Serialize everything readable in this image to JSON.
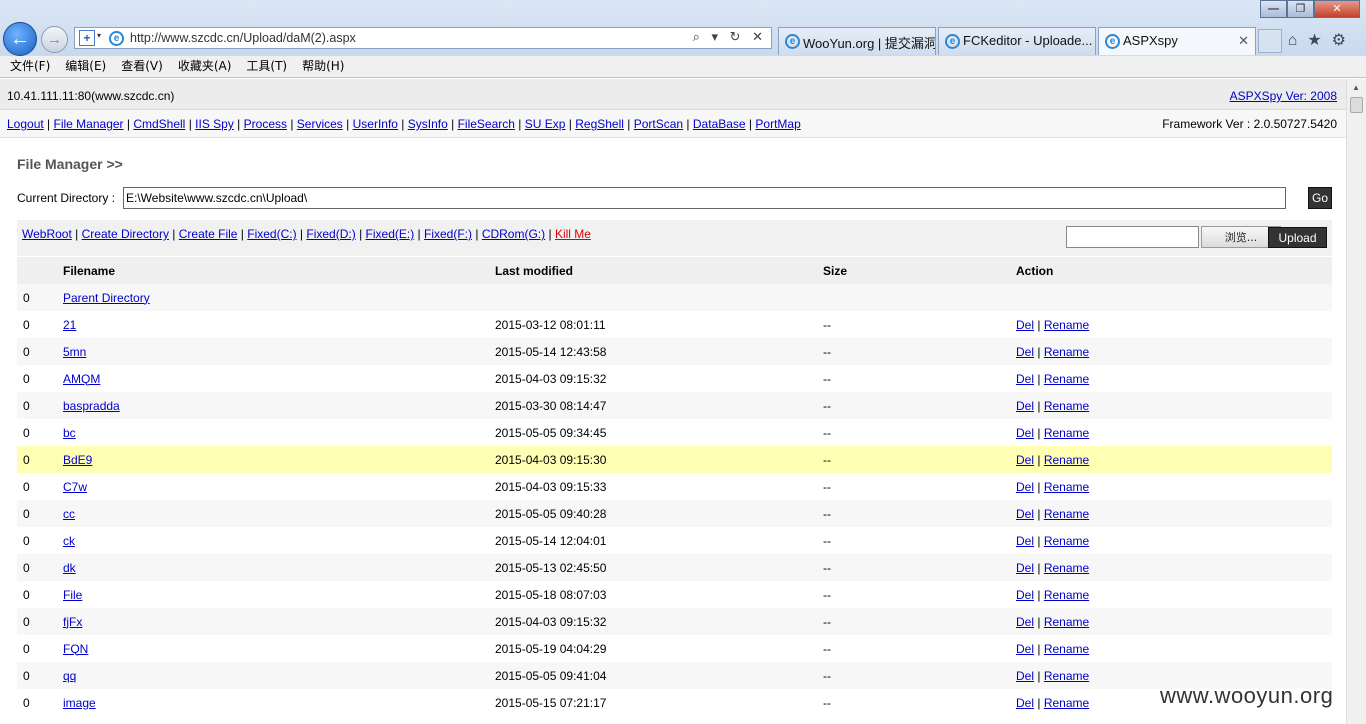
{
  "window": {
    "minimize": "—",
    "maximize": "❐",
    "close": "✕"
  },
  "address": {
    "url": "http://www.szcdc.cn/Upload/daM(2).aspx",
    "tools": "⌕ ▾ ↻ ✕"
  },
  "tabs": [
    {
      "label": "WooYun.org | 提交漏洞"
    },
    {
      "label": "FCKeditor - Uploade..."
    },
    {
      "label": "ASPXspy",
      "active": true,
      "close": "✕"
    }
  ],
  "toolbar_icons": [
    "home-icon",
    "star-icon",
    "gear-icon"
  ],
  "menu": [
    "文件(F)",
    "编辑(E)",
    "查看(V)",
    "收藏夹(A)",
    "工具(T)",
    "帮助(H)"
  ],
  "header": {
    "host": "10.41.111.11:80(www.szcdc.cn)",
    "version_link": "ASPXSpy Ver: 2008",
    "framework": "Framework Ver : 2.0.50727.5420"
  },
  "nav_links": [
    "Logout",
    "File Manager",
    "CmdShell",
    "IIS Spy",
    "Process",
    "Services",
    "UserInfo",
    "SysInfo",
    "FileSearch",
    "SU Exp",
    "RegShell",
    "PortScan",
    "DataBase",
    "PortMap"
  ],
  "file_manager": {
    "title": "File Manager >>",
    "current_dir_label": "Current Directory :",
    "current_dir_value": "E:\\Website\\www.szcdc.cn\\Upload\\",
    "go_label": "Go",
    "drive_links": [
      "WebRoot",
      "Create Directory",
      "Create File",
      "Fixed(C:)",
      "Fixed(D:)",
      "Fixed(E:)",
      "Fixed(F:)",
      "CDRom(G:)"
    ],
    "kill_label": "Kill Me",
    "browse_label": "浏览...",
    "upload_label": "Upload"
  },
  "table": {
    "headers": [
      "",
      "Filename",
      "Last modified",
      "Size",
      "Action"
    ],
    "parent": {
      "num": "0",
      "name": "Parent Directory"
    },
    "del_label": "Del",
    "rename_label": "Rename",
    "rows": [
      {
        "num": "0",
        "name": "21",
        "modified": "2015-03-12 08:01:11",
        "size": "--"
      },
      {
        "num": "0",
        "name": "5mn",
        "modified": "2015-05-14 12:43:58",
        "size": "--"
      },
      {
        "num": "0",
        "name": "AMQM",
        "modified": "2015-04-03 09:15:32",
        "size": "--"
      },
      {
        "num": "0",
        "name": "baspradda",
        "modified": "2015-03-30 08:14:47",
        "size": "--"
      },
      {
        "num": "0",
        "name": "bc",
        "modified": "2015-05-05 09:34:45",
        "size": "--"
      },
      {
        "num": "0",
        "name": "BdE9",
        "modified": "2015-04-03 09:15:30",
        "size": "--",
        "highlight": true
      },
      {
        "num": "0",
        "name": "C7w",
        "modified": "2015-04-03 09:15:33",
        "size": "--"
      },
      {
        "num": "0",
        "name": "cc",
        "modified": "2015-05-05 09:40:28",
        "size": "--"
      },
      {
        "num": "0",
        "name": "ck",
        "modified": "2015-05-14 12:04:01",
        "size": "--"
      },
      {
        "num": "0",
        "name": "dk",
        "modified": "2015-05-13 02:45:50",
        "size": "--"
      },
      {
        "num": "0",
        "name": "File",
        "modified": "2015-05-18 08:07:03",
        "size": "--"
      },
      {
        "num": "0",
        "name": "fjFx",
        "modified": "2015-04-03 09:15:32",
        "size": "--"
      },
      {
        "num": "0",
        "name": "FQN",
        "modified": "2015-05-19 04:04:29",
        "size": "--"
      },
      {
        "num": "0",
        "name": "qq",
        "modified": "2015-05-05 09:41:04",
        "size": "--"
      },
      {
        "num": "0",
        "name": "image",
        "modified": "2015-05-15 07:21:17",
        "size": "--"
      }
    ]
  },
  "watermark": "www.wooyun.org"
}
